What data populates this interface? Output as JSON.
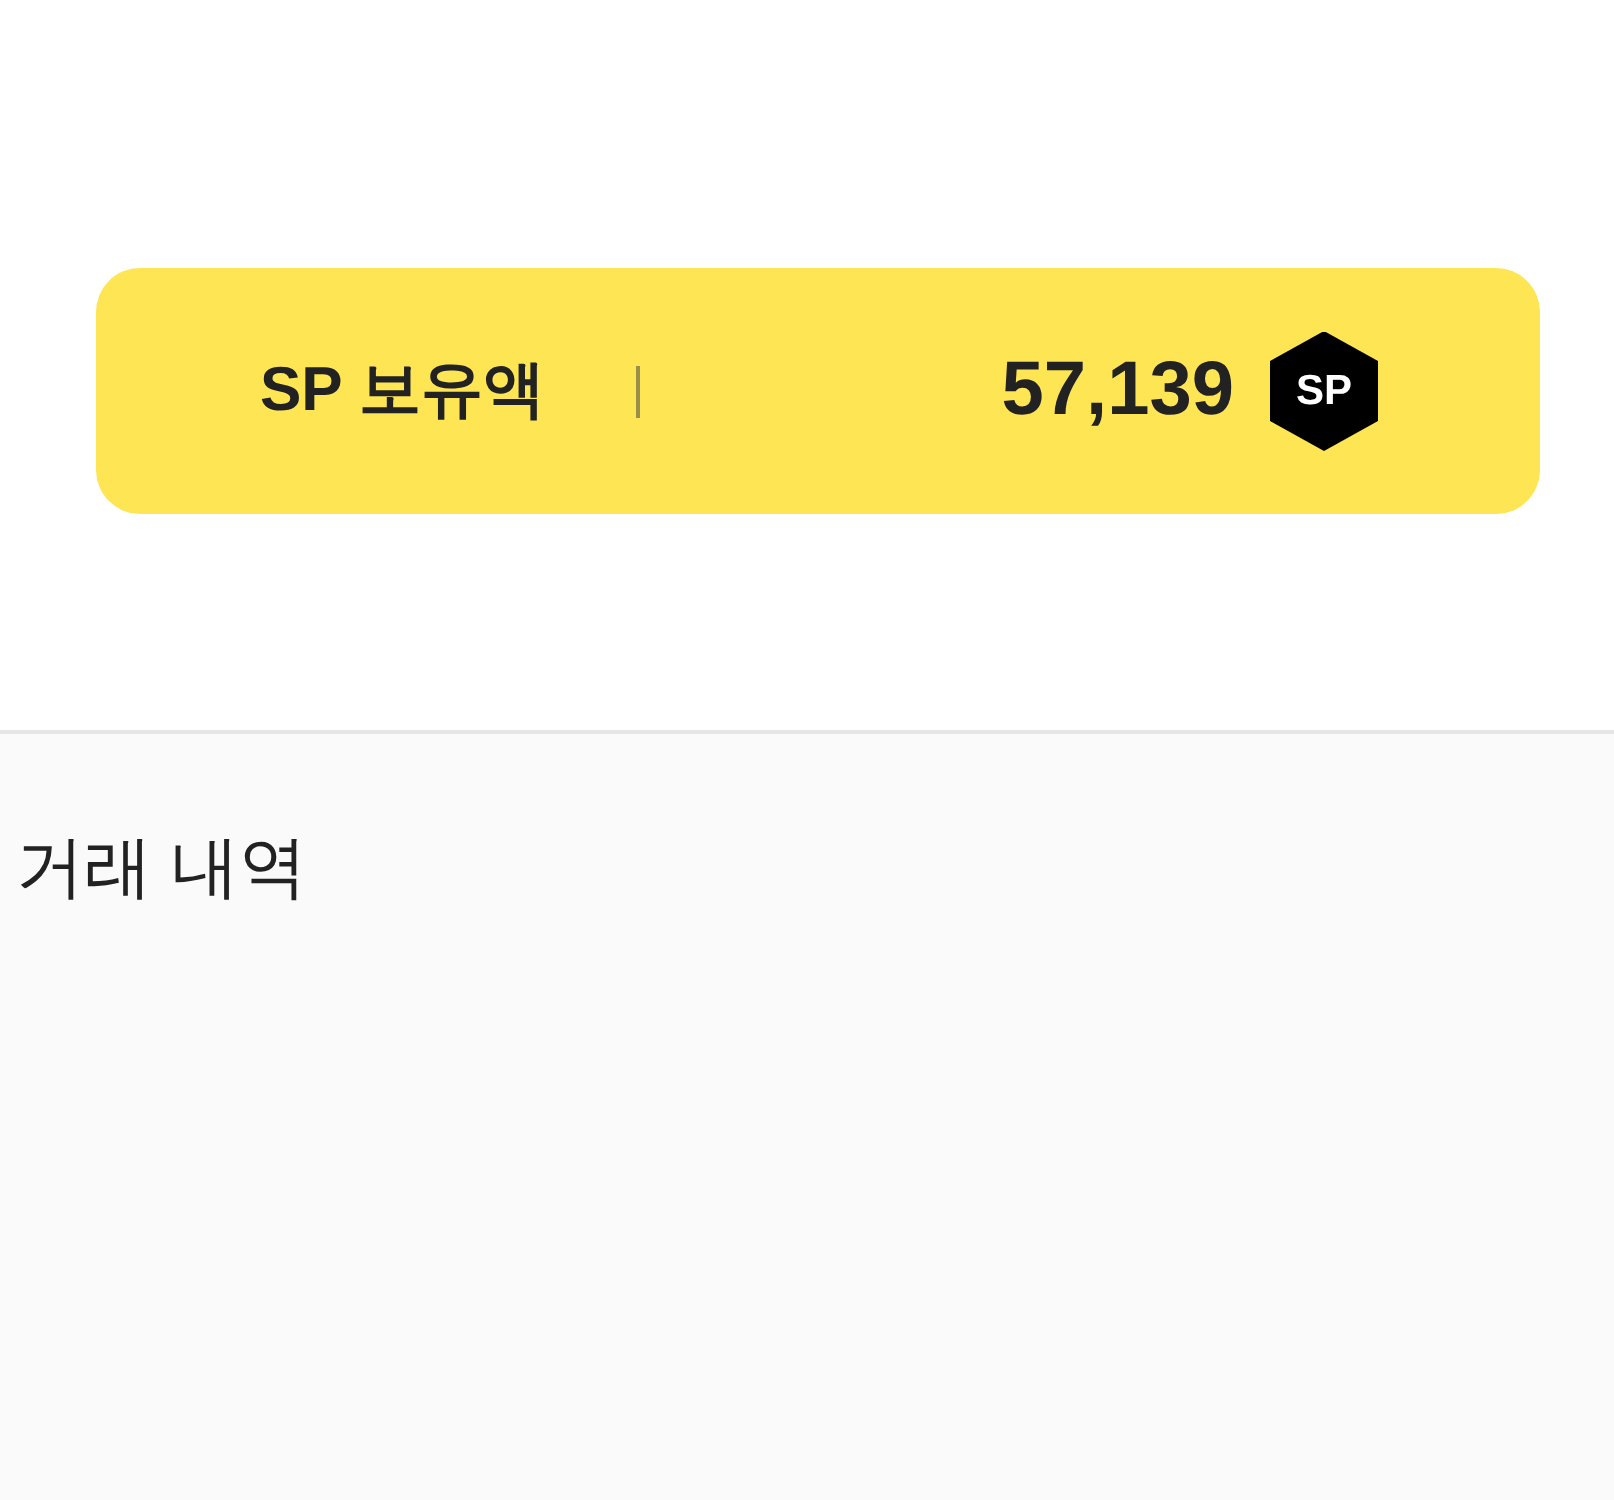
{
  "balance_card": {
    "label": "SP 보유액",
    "amount": "57,139",
    "badge": "SP"
  },
  "history": {
    "title": "거래 내역"
  }
}
